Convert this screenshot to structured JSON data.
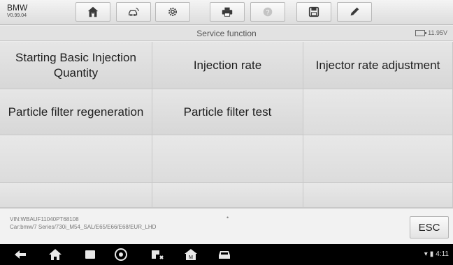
{
  "app": {
    "make": "BMW",
    "version": "V0.99.04"
  },
  "toolbar": [
    {
      "name": "home-icon",
      "disabled": false
    },
    {
      "name": "vehicle-swap-icon",
      "disabled": false
    },
    {
      "name": "settings-icon",
      "disabled": false
    },
    {
      "name": "print-icon",
      "disabled": false
    },
    {
      "name": "help-icon",
      "disabled": true
    },
    {
      "name": "save-icon",
      "disabled": false
    },
    {
      "name": "edit-icon",
      "disabled": false
    }
  ],
  "header": {
    "title": "Service function",
    "battery": "11.95V"
  },
  "functions": [
    "Starting Basic Injection Quantity",
    "Injection rate",
    "Injector rate adjustment",
    "Particle filter regeneration",
    "Particle filter test"
  ],
  "info": {
    "vin": "VIN:WBAUF11040PT68108",
    "car": "Car:bmw/7 Series/730i_M54_SAL/E65/E66/E68/EUR_LHD"
  },
  "esc_label": "ESC",
  "navbar": [
    "back-icon",
    "home-icon",
    "recent-apps-icon",
    "chrome-icon",
    "vci-icon",
    "maxisys-home-icon",
    "car-icon"
  ],
  "status": {
    "time": "4:11"
  }
}
